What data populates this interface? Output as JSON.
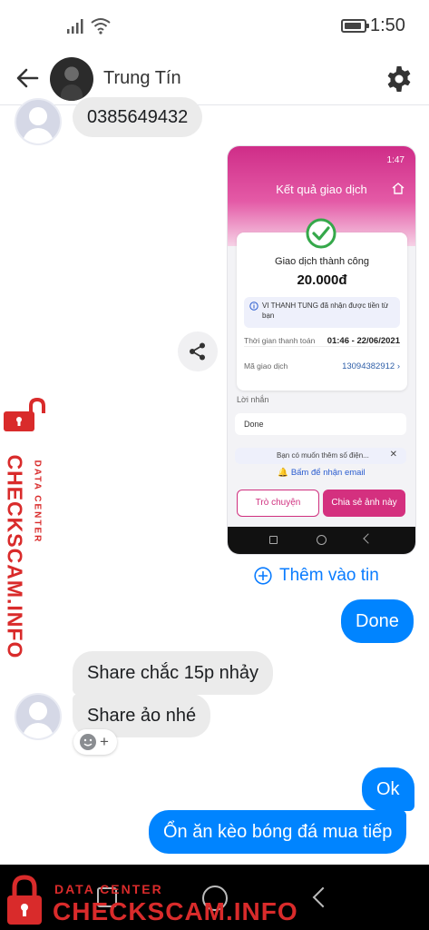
{
  "status_bar": {
    "time": "1:50"
  },
  "header": {
    "contact_name": "Trung Tín"
  },
  "messages": [
    {
      "direction": "incoming",
      "text": "0385649432"
    },
    {
      "direction": "outgoing",
      "text": "Done"
    },
    {
      "direction": "incoming",
      "text": "Share chắc 15p nhảy"
    },
    {
      "direction": "incoming",
      "text": "Share ảo nhé"
    },
    {
      "direction": "outgoing",
      "text": "Ok"
    },
    {
      "direction": "outgoing",
      "text": "Ổn ăn kèo bóng đá mua tiếp"
    }
  ],
  "attachment": {
    "status_time": "1:47",
    "title": "Kết quả giao dịch",
    "success_text": "Giao dịch thành công",
    "amount": "20.000đ",
    "info_text": "VI THANH TUNG đã nhận được tiền từ bạn",
    "time_label": "Thời gian thanh toán",
    "time_value": "01:46 - 22/06/2021",
    "code_label": "Mã giao dịch",
    "code_value": "13094382912",
    "message_label": "Lời nhắn",
    "message_value": "Done",
    "prompt_text": "Bạn có muốn thêm số điện...",
    "email_prompt": "Bấm để nhận email",
    "chat_button": "Trò chuyện",
    "share_button": "Chia sẻ ảnh này"
  },
  "add_to_story": "Thêm vào tin",
  "watermark": {
    "side_small": "DATA CENTER",
    "side_big": "CHECKSCAM.INFO",
    "bottom_small": "DATA CENTER",
    "bottom_big": "CHECKSCAM.INFO"
  },
  "colors": {
    "outgoing_bubble": "#0084ff",
    "incoming_bubble": "#ebebeb",
    "accent_pink": "#d4307f",
    "watermark_red": "#d92b2b"
  }
}
